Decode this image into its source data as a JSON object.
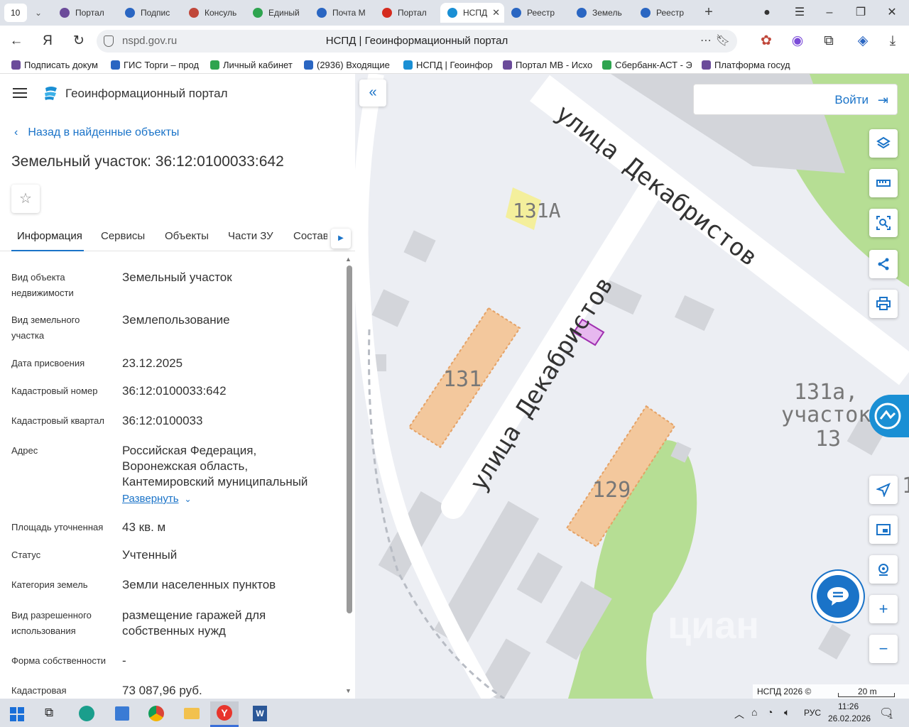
{
  "browser": {
    "tab_count": "10",
    "tabs": [
      {
        "label": "Портал",
        "color": "#6b4b9a"
      },
      {
        "label": "Подпис",
        "color": "#2a66c2"
      },
      {
        "label": "Консуль",
        "color": "#c0473a"
      },
      {
        "label": "Единый",
        "color": "#2ea44f"
      },
      {
        "label": "Почта M",
        "color": "#2a66c2"
      },
      {
        "label": "Портал",
        "color": "#d52b1e"
      },
      {
        "label": "НСПД",
        "color": "#1a8fd4"
      },
      {
        "label": "Реестр",
        "color": "#2a66c2"
      },
      {
        "label": "Земель",
        "color": "#2a66c2"
      },
      {
        "label": "Реестр",
        "color": "#2a66c2"
      }
    ],
    "url_host": "nspd.gov.ru",
    "page_title": "НСПД | Геоинформационный портал",
    "bookmarks": [
      "Подписать докум",
      "ГИС Торги – прод",
      "Личный кабинет",
      "(2936) Входящие",
      "НСПД | Геоинфор",
      "Портал МВ - Исхо",
      "Сбербанк-АСТ - Э",
      "Платформа госуд"
    ]
  },
  "app": {
    "title": "Геоинформационный портал",
    "back_link": "Назад в найденные объекты",
    "object_title": "Земельный участок: 36:12:0100033:642",
    "tabs": [
      "Информация",
      "Сервисы",
      "Объекты",
      "Части ЗУ",
      "Состав"
    ],
    "rows": [
      {
        "label": "Вид объекта недвижимости",
        "value": "Земельный участок"
      },
      {
        "label": "Вид земельного участка",
        "value": "Землепользование"
      },
      {
        "label": "Дата присвоения",
        "value": "23.12.2025"
      },
      {
        "label": "Кадастровый номер",
        "value": "36:12:0100033:642"
      },
      {
        "label": "Кадастровый квартал",
        "value": "36:12:0100033"
      },
      {
        "label": "Адрес",
        "value": "Российская Федерация, Воронежская область, Кантемировский муниципальный"
      },
      {
        "label": "Площадь уточненная",
        "value": "43 кв. м"
      },
      {
        "label": "Статус",
        "value": "Учтенный"
      },
      {
        "label": "Категория земель",
        "value": "Земли населенных пунктов"
      },
      {
        "label": "Вид разрешенного использования",
        "value": "размещение гаражей для собственных нужд"
      },
      {
        "label": "Форма собственности",
        "value": "-"
      },
      {
        "label": "Кадастровая",
        "value": "73 087,96 руб."
      }
    ],
    "expand_label": "Развернуть"
  },
  "map": {
    "login_label": "Войти",
    "street_labels": [
      "улица Декабристов",
      "улица Декабристов"
    ],
    "building_labels": [
      "131А",
      "131",
      "129",
      "131а,",
      "участок",
      "13",
      "1"
    ],
    "attribution": "НСПД 2026 ©",
    "scale_label": "20 m",
    "watermark": "циан",
    "colors": {
      "road": "#ffffff",
      "building": "#f3c89d",
      "park": "#b6de94",
      "selected_parcel": "#e7b8ef",
      "accent": "#1a73c8"
    }
  },
  "taskbar": {
    "lang": "РУС",
    "time": "11:26",
    "date": "26.02.2026",
    "notification_count": "1"
  }
}
